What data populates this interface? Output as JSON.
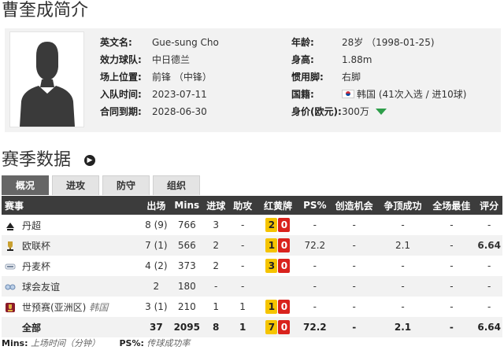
{
  "page_title": "曹奎成简介",
  "profile": {
    "left": [
      {
        "label": "英文名:",
        "value": "Gue-sung Cho"
      },
      {
        "label": "效力球队:",
        "value": "中日德兰"
      },
      {
        "label": "场上位置:",
        "value": "前锋 （中锋）"
      },
      {
        "label": "入队时间:",
        "value": "2023-07-11"
      },
      {
        "label": "合同到期:",
        "value": "2028-06-30"
      }
    ],
    "right": [
      {
        "label": "年龄:",
        "value": "28岁 （1998-01-25)"
      },
      {
        "label": "身高:",
        "value": "1.88m"
      },
      {
        "label": "惯用脚:",
        "value": "右脚"
      },
      {
        "label": "国籍:",
        "value": "韩国 (41次入选 / 进10球)",
        "flag_icon": "south-korea-flag-icon"
      },
      {
        "label": "身价(欧元):",
        "value": "300万",
        "trend": "down",
        "trend_color": "#2e9e4a"
      }
    ]
  },
  "section_title": "赛季数据",
  "tabs": [
    {
      "label": "概况",
      "active": true
    },
    {
      "label": "进攻",
      "active": false
    },
    {
      "label": "防守",
      "active": false
    },
    {
      "label": "组织",
      "active": false
    }
  ],
  "table": {
    "headers": [
      "赛事",
      "出场",
      "Mins",
      "进球",
      "助攻",
      "红黄牌",
      "PS%",
      "创造机会",
      "争顶成功",
      "全场最佳",
      "评分"
    ],
    "rows": [
      {
        "comp": "丹超",
        "note": "",
        "icon": "danish-superliga-icon",
        "apps": "8 (9)",
        "mins": "766",
        "goals": "3",
        "assists": "-",
        "yellow": "2",
        "red": "0",
        "ps": "-",
        "chances": "-",
        "aerials": "-",
        "motm": "-",
        "rating": "-"
      },
      {
        "comp": "欧联杯",
        "note": "",
        "icon": "europa-league-trophy-icon",
        "apps": "7 (1)",
        "mins": "566",
        "goals": "2",
        "assists": "-",
        "yellow": "1",
        "red": "0",
        "ps": "72.2",
        "chances": "-",
        "aerials": "2.1",
        "motm": "-",
        "rating": "6.64"
      },
      {
        "comp": "丹麦杯",
        "note": "",
        "icon": "danish-cup-icon",
        "apps": "4 (2)",
        "mins": "373",
        "goals": "2",
        "assists": "-",
        "yellow": "3",
        "red": "0",
        "ps": "-",
        "chances": "-",
        "aerials": "-",
        "motm": "-",
        "rating": "-"
      },
      {
        "comp": "球会友谊",
        "note": "",
        "icon": "club-friendly-icon",
        "apps": "2",
        "mins": "180",
        "goals": "-",
        "assists": "-",
        "yellow": "",
        "red": "",
        "ps": "-",
        "chances": "-",
        "aerials": "-",
        "motm": "-",
        "rating": "-"
      },
      {
        "comp": "世预赛(亚洲区)",
        "note": "韩国",
        "icon": "world-cup-qualifiers-icon",
        "apps": "3 (1)",
        "mins": "210",
        "goals": "1",
        "assists": "1",
        "yellow": "1",
        "red": "0",
        "ps": "-",
        "chances": "-",
        "aerials": "-",
        "motm": "-",
        "rating": "-"
      }
    ],
    "total": {
      "comp": "全部",
      "apps": "37",
      "mins": "2095",
      "goals": "8",
      "assists": "1",
      "yellow": "7",
      "red": "0",
      "ps": "72.2",
      "chances": "-",
      "aerials": "2.1",
      "motm": "-",
      "rating": "6.64"
    }
  },
  "footnote": {
    "mins_key": "Mins:",
    "mins_desc": "上场时间（分钟）",
    "ps_key": "PS%:",
    "ps_desc": "传球成功率"
  },
  "colors": {
    "header_bg": "#3c3c3c",
    "rating": "#e77f0e",
    "yellow_card": "#f5c400",
    "red_card": "#d9231d"
  }
}
